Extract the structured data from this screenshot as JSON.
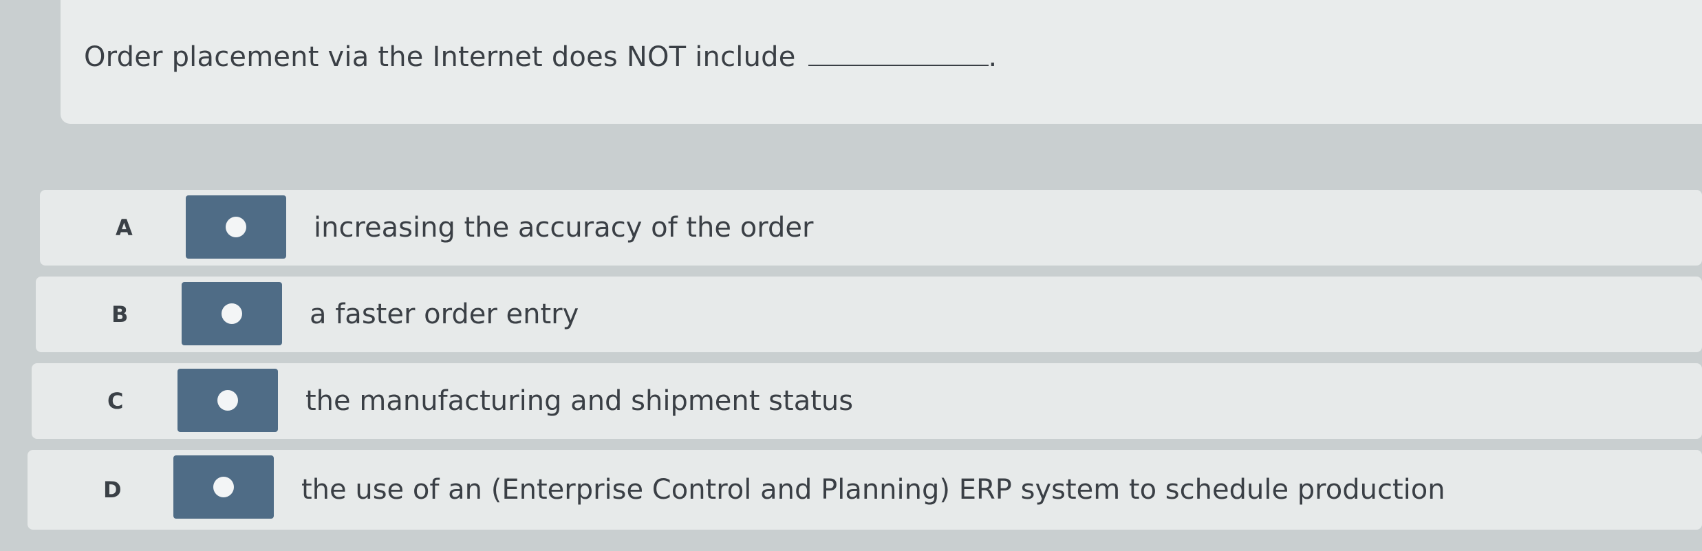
{
  "question": {
    "text": "Order placement via the Internet does NOT include",
    "end_punct": "."
  },
  "options": [
    {
      "letter": "A",
      "text": "increasing the accuracy of the order"
    },
    {
      "letter": "B",
      "text": "a faster order entry"
    },
    {
      "letter": "C",
      "text": "the manufacturing and shipment status"
    },
    {
      "letter": "D",
      "text": "the use of an (Enterprise Control and Planning) ERP system to schedule production"
    }
  ],
  "colors": {
    "radio_box": "#4f6c86",
    "panel": "#e9ecec",
    "background": "#c9cfd0"
  }
}
